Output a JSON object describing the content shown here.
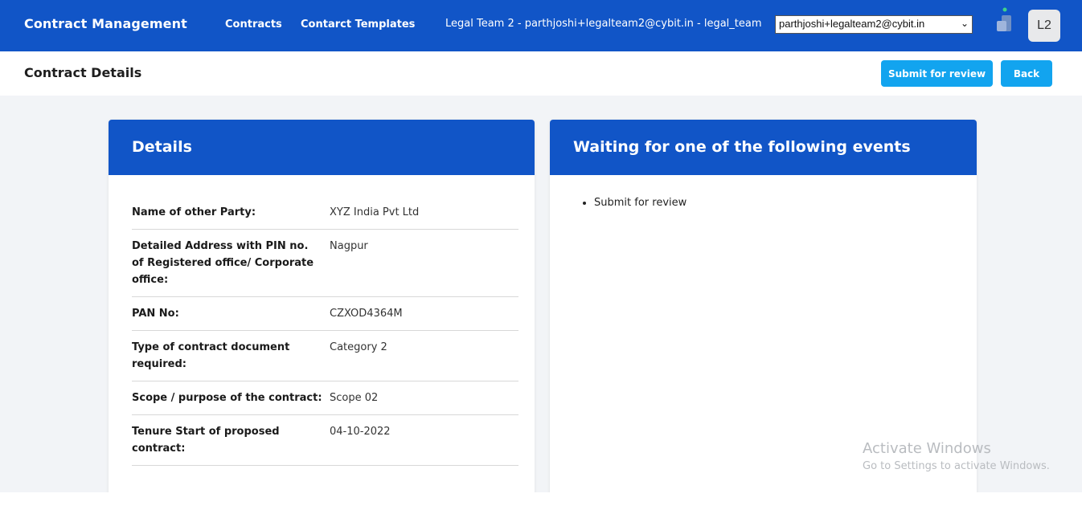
{
  "header": {
    "brand": "Contract Management",
    "nav": [
      "Contracts",
      "Contarct Templates"
    ],
    "user_info": "Legal Team 2 - parthjoshi+legalteam2@cybit.in - legal_team",
    "user_select": "parthjoshi+legalteam2@cybit.in",
    "avatar": "L2",
    "app_icon": "app-switcher-icon"
  },
  "subbar": {
    "title": "Contract Details",
    "submit_label": "Submit for review",
    "back_label": "Back"
  },
  "details": {
    "title": "Details",
    "rows": [
      {
        "label": "Name of other Party:",
        "value": "XYZ India Pvt Ltd"
      },
      {
        "label": "Detailed Address with PIN no. of Registered office/ Corporate office:",
        "value": "Nagpur"
      },
      {
        "label": "PAN No:",
        "value": "CZXOD4364M"
      },
      {
        "label": "Type of contract document required:",
        "value": "Category 2"
      },
      {
        "label": "Scope / purpose of the contract:",
        "value": "Scope 02"
      },
      {
        "label": "Tenure Start of proposed contract:",
        "value": "04-10-2022"
      }
    ]
  },
  "events": {
    "title": "Waiting for one of the following events",
    "items": [
      "Submit for review"
    ]
  },
  "watermark": {
    "title": "Activate Windows",
    "subtitle": "Go to Settings to activate Windows."
  },
  "colors": {
    "primary": "#1155c7",
    "button": "#12a4ef",
    "background": "#f2f4f7"
  }
}
